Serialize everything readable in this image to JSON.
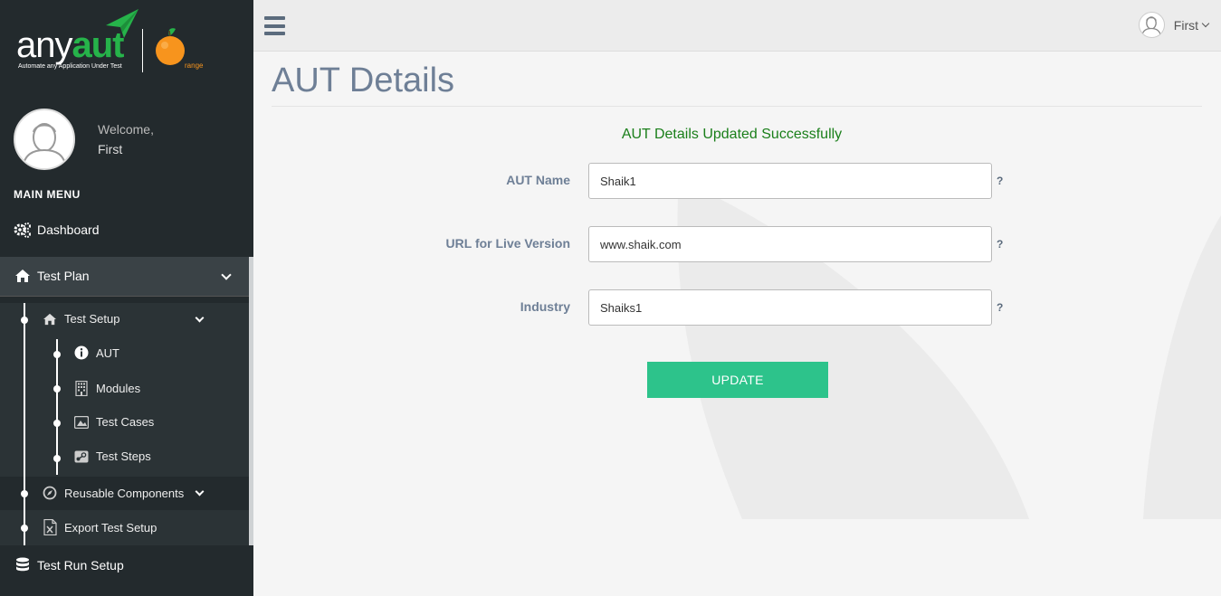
{
  "brand": {
    "name_part1": "any",
    "name_part2": "aut",
    "tagline": "Automate any Application Under Test",
    "partner_suffix": "range"
  },
  "profile": {
    "welcome": "Welcome,",
    "name": "First"
  },
  "sidebar": {
    "menu_title": "MAIN MENU",
    "dashboard": {
      "label": "Dashboard",
      "icon": "cogs-icon"
    },
    "test_plan": {
      "label": "Test Plan",
      "icon": "home-icon"
    },
    "test_setup": {
      "label": "Test Setup",
      "icon": "home-icon"
    },
    "sub_items": [
      {
        "label": "AUT",
        "icon": "info-circle-icon"
      },
      {
        "label": "Modules",
        "icon": "building-icon"
      },
      {
        "label": "Test Cases",
        "icon": "picture-icon"
      },
      {
        "label": "Test Steps",
        "icon": "steam-icon"
      }
    ],
    "reusable": {
      "label": "Reusable Components",
      "icon": "compass-icon"
    },
    "export": {
      "label": "Export Test Setup",
      "icon": "file-excel-icon"
    },
    "test_run": {
      "label": "Test Run Setup",
      "icon": "database-icon"
    }
  },
  "topbar": {
    "user_name": "First"
  },
  "main": {
    "title": "AUT Details",
    "success_message": "AUT Details Updated Successfully",
    "fields": [
      {
        "label": "AUT Name",
        "value": "Shaik1",
        "help": "?"
      },
      {
        "label": "URL for Live Version",
        "value": "www.shaik.com",
        "help": "?"
      },
      {
        "label": "Industry",
        "value": "Shaiks1",
        "help": "?"
      }
    ],
    "update_label": "UPDATE"
  },
  "colors": {
    "sidebar_bg": "#232a2d",
    "brand_green": "#26b34a",
    "accent_button": "#2dc38b",
    "success_text": "#1a7f1a",
    "title_text": "#6e7f96"
  }
}
